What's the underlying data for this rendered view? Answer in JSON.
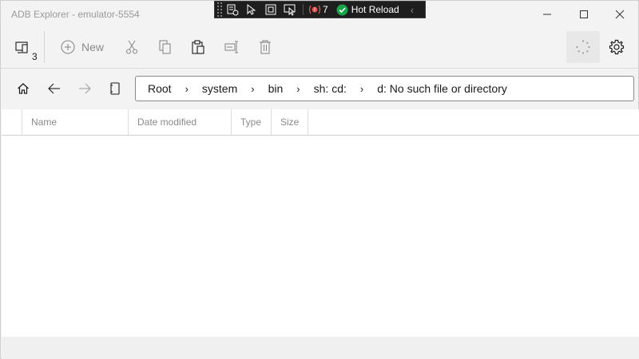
{
  "window": {
    "title": "ADB Explorer - emulator-5554"
  },
  "debug_toolbar": {
    "error_count": "7",
    "hot_reload_label": "Hot Reload"
  },
  "toolbar": {
    "device_count": "3",
    "new_label": "New"
  },
  "breadcrumb": [
    "Root",
    "system",
    "bin",
    "sh: cd:",
    "d: No such file or directory"
  ],
  "columns": [
    "Name",
    "Date modified",
    "Type",
    "Size"
  ],
  "colors": {
    "accent_green": "#16a34a",
    "debug_bg": "#1e1e1e",
    "error_red": "#e05252"
  }
}
